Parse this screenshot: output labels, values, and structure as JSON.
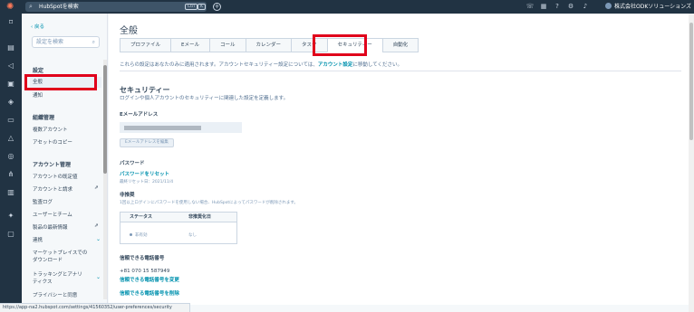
{
  "topbar": {
    "search_placeholder": "HubSpotを検索",
    "kbd1": "Ctrl",
    "kbd2": "K",
    "plus": "+",
    "account": "株式会社ODKソリューションズ",
    "account_caret": "▾"
  },
  "sidebar": {
    "back": "戻る",
    "search_placeholder": "設定を検索",
    "sections": [
      {
        "title": "設定"
      },
      {
        "title": "組織管理"
      },
      {
        "title": "アカウント管理"
      }
    ],
    "items": [
      {
        "label": "全般"
      },
      {
        "label": "通知"
      },
      {
        "label": "複数アカウント"
      },
      {
        "label": "アセットのコピー"
      },
      {
        "label": "アカウントの既定値"
      },
      {
        "label": "アカウントと請求"
      },
      {
        "label": "監査ログ"
      },
      {
        "label": "ユーザーとチーム"
      },
      {
        "label": "製品の最新情報"
      },
      {
        "label": "連携"
      },
      {
        "label": "マーケットプレイスでの"
      },
      {
        "label": "ダウンロード"
      },
      {
        "label": "トラッキングとアナリ"
      },
      {
        "label": "ティクス"
      },
      {
        "label": "プライバシーと同意"
      }
    ]
  },
  "main": {
    "page_title": "全般",
    "tabs": [
      {
        "label": "プロファイル"
      },
      {
        "label": "Eメール"
      },
      {
        "label": "コール"
      },
      {
        "label": "カレンダー"
      },
      {
        "label": "タスク"
      },
      {
        "label": "セキュリティー"
      },
      {
        "label": "自動化"
      }
    ],
    "notice_prefix": "これらの設定はあなたのみに適用されます。アカウントセキュリティー設定については、",
    "notice_link": "アカウント設定",
    "notice_suffix": "に移動してください。",
    "security": {
      "title": "セキュリティー",
      "description": "ログインや個人アカウントのセキュリティーに関連した設定を定義します。",
      "email_label": "Eメールアドレス",
      "edit_email_button": "Eメールアドレスを編集",
      "password_label": "パスワード",
      "reset_password_link": "パスワードをリセット",
      "last_reset": "最終リセット日：2021/11/4",
      "passwordless_label": "非推奨",
      "passwordless_desc": "1回以上ログインにパスワードを使用しない場合、HubSpotによってパスワードが削除されます。",
      "table": {
        "col_status": "ステータス",
        "col_deprecated": "非推奨化日",
        "status_value": "非有効",
        "deprecated_value": "なし"
      },
      "phone_label": "信頼できる電話番号",
      "phone_value": "+81 070 15 587949",
      "change_phone_link": "信頼できる電話番号を変更",
      "delete_phone_link": "信頼できる電話番号を削除"
    }
  },
  "statusbar": {
    "url": "https://app-na2.hubspot.com/settings/41560352/user-preferences/security"
  },
  "colors": {
    "topbar": "#213343",
    "link": "#0091ae",
    "highlight": "#e0001b",
    "brand": "#ff7a59"
  }
}
